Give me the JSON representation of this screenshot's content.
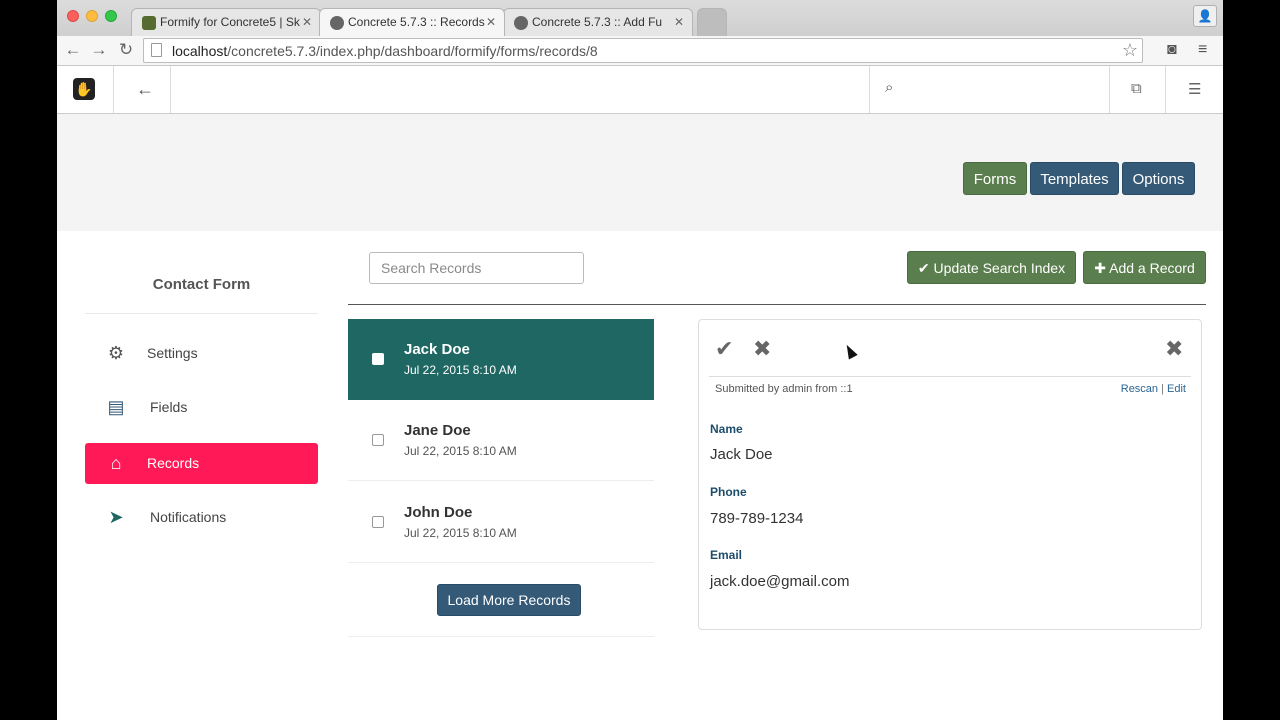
{
  "browser": {
    "tabs": [
      {
        "title": "Formify for Concrete5 | Sk"
      },
      {
        "title": "Concrete 5.7.3 :: Records"
      },
      {
        "title": "Concrete 5.7.3 :: Add Fu"
      }
    ],
    "url_host": "localhost",
    "url_path": "/concrete5.7.3/index.php/dashboard/formify/forms/records/8"
  },
  "header": {
    "buttons": {
      "forms": "Forms",
      "templates": "Templates",
      "options": "Options"
    },
    "colors": {
      "green": "#5a7e4d",
      "navy": "#345a78"
    }
  },
  "sidebar": {
    "form_title": "Contact Form",
    "items": [
      {
        "label": "Settings",
        "icon": "gear-icon"
      },
      {
        "label": "Fields",
        "icon": "list-icon"
      },
      {
        "label": "Records",
        "icon": "inbox-icon",
        "active": true
      },
      {
        "label": "Notifications",
        "icon": "paper-plane-icon"
      }
    ],
    "active_color": "#ff1a57"
  },
  "records_panel": {
    "search_placeholder": "Search Records",
    "update_index_label": "Update Search Index",
    "add_record_label": "Add a Record",
    "records": [
      {
        "name": "Jack Doe",
        "date": "Jul 22, 2015 8:10 AM",
        "selected": true
      },
      {
        "name": "Jane Doe",
        "date": "Jul 22, 2015 8:10 AM",
        "selected": false
      },
      {
        "name": "John Doe",
        "date": "Jul 22, 2015 8:10 AM",
        "selected": false
      }
    ],
    "load_more_label": "Load More Records",
    "selected_color": "#1e6763"
  },
  "detail": {
    "submitted_text": "Submitted by admin from ::1",
    "rescan_label": "Rescan",
    "separator": "|",
    "edit_label": "Edit",
    "fields": [
      {
        "label": "Name",
        "value": "Jack Doe"
      },
      {
        "label": "Phone",
        "value": "789-789-1234"
      },
      {
        "label": "Email",
        "value": "jack.doe@gmail.com"
      }
    ]
  }
}
